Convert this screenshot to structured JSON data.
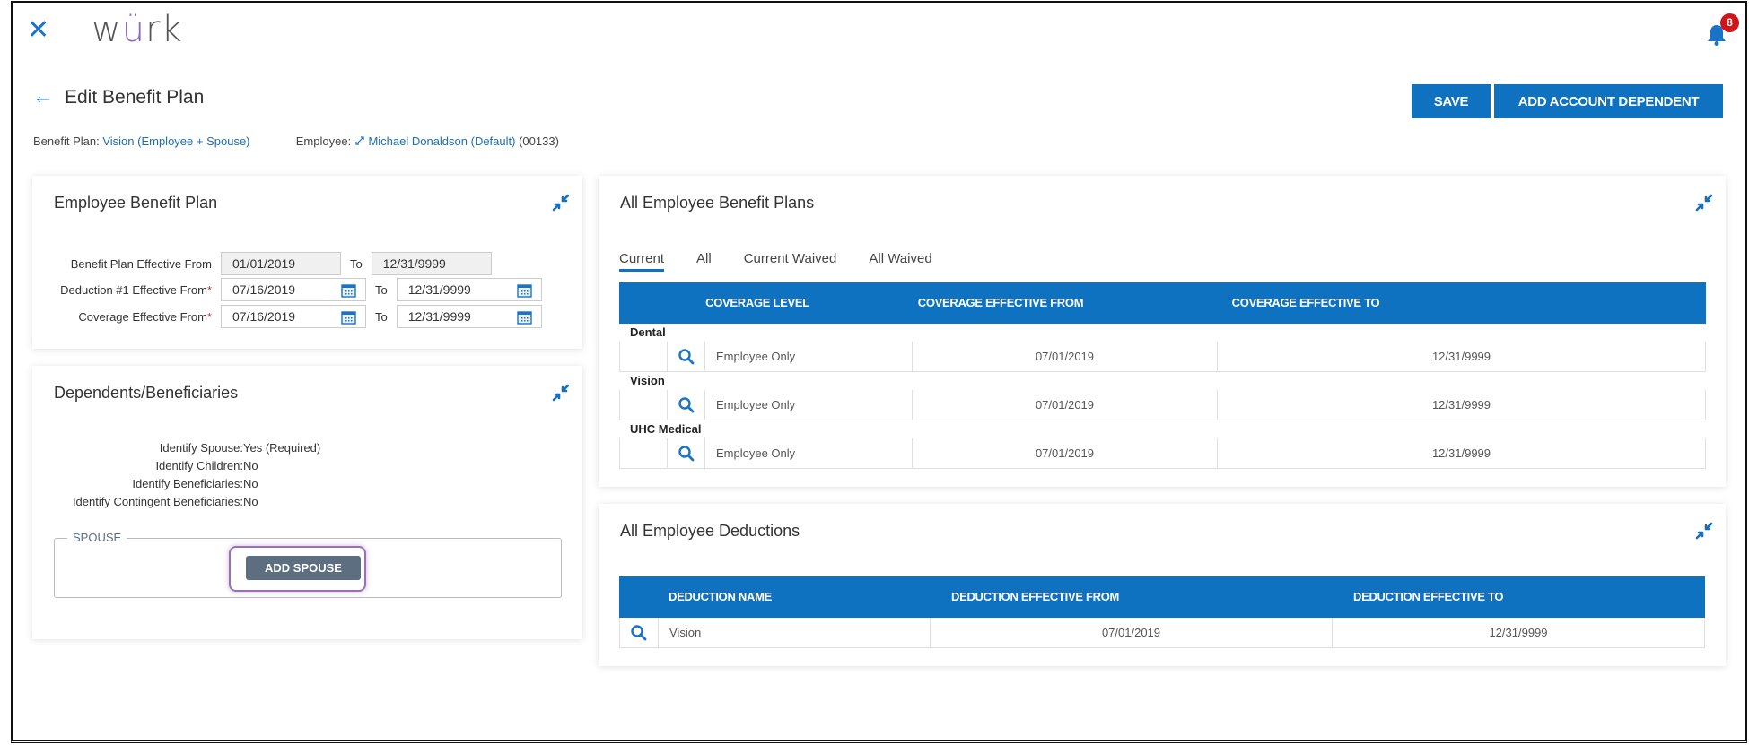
{
  "app": {
    "logo_prefix": "w",
    "logo_accent": "ü",
    "logo_suffix": "rk",
    "close_icon": "close-icon",
    "notifications_count": "8",
    "brand_color": "#0e72c0",
    "accent_color": "#8a6bb8"
  },
  "header": {
    "title": "Edit Benefit Plan",
    "save_label": "SAVE",
    "add_dependent_label": "ADD ACCOUNT DEPENDENT"
  },
  "info": {
    "benefit_plan_label": "Benefit Plan:",
    "benefit_plan_value": "Vision (Employee + Spouse)",
    "employee_label": "Employee:",
    "employee_name": "Michael Donaldson (Default)",
    "employee_id": "(00133)"
  },
  "employee_benefit_plan": {
    "title": "Employee Benefit Plan",
    "to_label": "To",
    "rows": [
      {
        "label": "Benefit Plan Effective From",
        "required": false,
        "from": "01/01/2019",
        "to": "12/31/9999",
        "readonly": true
      },
      {
        "label": "Deduction #1 Effective From",
        "required": true,
        "from": "07/16/2019",
        "to": "12/31/9999",
        "readonly": false
      },
      {
        "label": "Coverage Effective From",
        "required": true,
        "from": "07/16/2019",
        "to": "12/31/9999",
        "readonly": false
      }
    ],
    "required_mark": "*"
  },
  "dependents": {
    "title": "Dependents/Beneficiaries",
    "items": [
      {
        "label": "Identify Spouse:",
        "value": "Yes (Required)"
      },
      {
        "label": "Identify Children:",
        "value": "No"
      },
      {
        "label": "Identify Beneficiaries:",
        "value": "No"
      },
      {
        "label": "Identify Contingent Beneficiaries:",
        "value": "No"
      }
    ],
    "spouse_legend": "SPOUSE",
    "add_spouse_label": "ADD SPOUSE"
  },
  "all_benefit_plans": {
    "title": "All Employee Benefit Plans",
    "tabs": [
      {
        "label": "Current",
        "active": true
      },
      {
        "label": "All",
        "active": false
      },
      {
        "label": "Current Waived",
        "active": false
      },
      {
        "label": "All Waived",
        "active": false
      }
    ],
    "columns": [
      "COVERAGE LEVEL",
      "COVERAGE EFFECTIVE FROM",
      "COVERAGE EFFECTIVE TO"
    ],
    "groups": [
      {
        "name": "Dental",
        "coverage_level": "Employee Only",
        "from": "07/01/2019",
        "to": "12/31/9999"
      },
      {
        "name": "Vision",
        "coverage_level": "Employee Only",
        "from": "07/01/2019",
        "to": "12/31/9999"
      },
      {
        "name": "UHC Medical",
        "coverage_level": "Employee Only",
        "from": "07/01/2019",
        "to": "12/31/9999"
      }
    ]
  },
  "all_deductions": {
    "title": "All Employee Deductions",
    "columns": [
      "DEDUCTION NAME",
      "DEDUCTION EFFECTIVE FROM",
      "DEDUCTION EFFECTIVE TO"
    ],
    "rows": [
      {
        "name": "Vision",
        "from": "07/01/2019",
        "to": "12/31/9999"
      }
    ]
  }
}
